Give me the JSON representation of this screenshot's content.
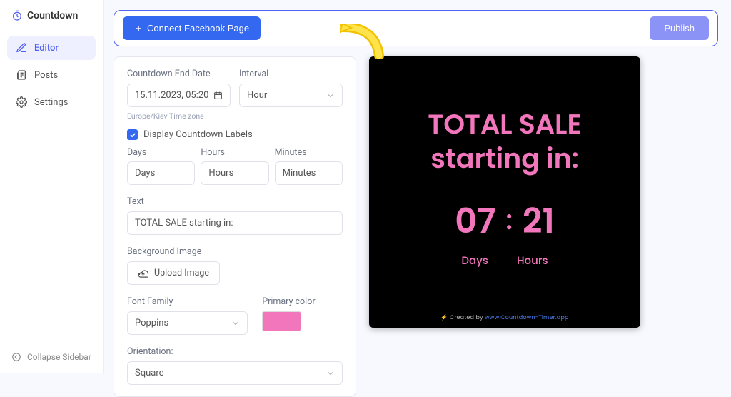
{
  "brand": "Countdown",
  "nav": {
    "editor": "Editor",
    "posts": "Posts",
    "settings": "Settings"
  },
  "collapse": "Collapse Sidebar",
  "topbar": {
    "connect": "Connect Facebook Page",
    "publish": "Publish"
  },
  "panel": {
    "endDateLabel": "Countdown End Date",
    "endDateValue": "15.11.2023, 05:20",
    "intervalLabel": "Interval",
    "intervalValue": "Hour",
    "tz": "Europe/Kiev Time zone",
    "displayLabels": "Display Countdown Labels",
    "daysLabel": "Days",
    "daysValue": "Days",
    "hoursLabel": "Hours",
    "hoursValue": "Hours",
    "minutesLabel": "Minutes",
    "minutesValue": "Minutes",
    "textLabel": "Text",
    "textValue": "TOTAL SALE starting in:",
    "bgLabel": "Background Image",
    "upload": "Upload Image",
    "fontLabel": "Font Family",
    "fontValue": "Poppins",
    "colorLabel": "Primary color",
    "colorValue": "#f176bb",
    "orientationLabel": "Orientation:",
    "orientationValue": "Square"
  },
  "preview": {
    "line1": "TOTAL SALE",
    "line2": "starting in:",
    "days": "07",
    "hours": "21",
    "dayLabel": "Days",
    "hourLabel": "Hours",
    "creditPrefix": "⚡",
    "creditBy": "Created by",
    "creditLink": "www.Countdown-Timer.app"
  }
}
